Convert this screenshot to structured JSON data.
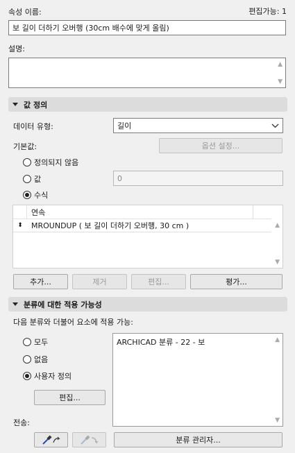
{
  "header": {
    "property_name_label": "속성 이름:",
    "editable_label": "편집가능: 1",
    "property_name_value": "보 길이 더하기 오버행 (30cm 배수에 맞게 올림)",
    "description_label": "설명:",
    "description_value": ""
  },
  "value_definition": {
    "section_title": "값 정의",
    "data_type_label": "데이터 유형:",
    "data_type_value": "길이",
    "default_label": "기본값:",
    "options_button": "옵션 설정...",
    "radio_undefined": "정의되지 않음",
    "radio_value": "값",
    "value_input": "0",
    "radio_expression": "수식",
    "selected_radio": "expression",
    "expression_header": "연속",
    "expression_row": "MROUNDUP ( 보 길이 더하기 오버행, 30 cm )",
    "buttons": {
      "add": "추가...",
      "remove": "제거",
      "edit": "편집...",
      "evaluate": "평가..."
    }
  },
  "classification": {
    "section_title": "분류에 대한 적용 가능성",
    "applies_label": "다음 분류와 더불어 요소에 적용 가능:",
    "radio_all": "모두",
    "radio_none": "없음",
    "radio_custom": "사용자 정의",
    "selected_radio": "custom",
    "edit_button": "편집...",
    "list_items": [
      "ARCHICAD 분류 - 22 - 보"
    ],
    "transfer_label": "전송:",
    "manager_button": "분류 관리자..."
  },
  "icons": {
    "dropdown": "chevron-down-icon",
    "eyedropper": "eyedropper-icon",
    "inject": "syringe-icon",
    "row_handle": "drag-handle-icon"
  }
}
